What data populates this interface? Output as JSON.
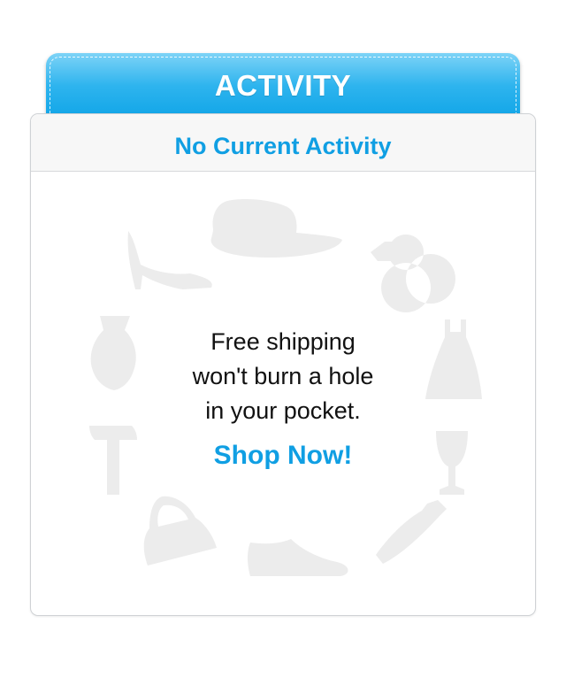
{
  "header": {
    "tab_title": "ACTIVITY",
    "accent_color": "#0aa2e6"
  },
  "panel": {
    "heading": "No Current Activity",
    "heading_color": "#109fe3"
  },
  "promo": {
    "lines": [
      "Free shipping",
      "won't burn a hole",
      "in your pocket."
    ],
    "cta_label": "Shop Now!",
    "text_color": "#111111",
    "cta_color": "#109fe3"
  },
  "background_icons": [
    "hat-icon",
    "ring-icon",
    "dress-icon",
    "wine-glass-icon",
    "tie-icon",
    "shoe-icon",
    "handbag-icon",
    "hammer-icon",
    "vase-icon",
    "high-heel-icon"
  ],
  "icon_color": "#ececec"
}
